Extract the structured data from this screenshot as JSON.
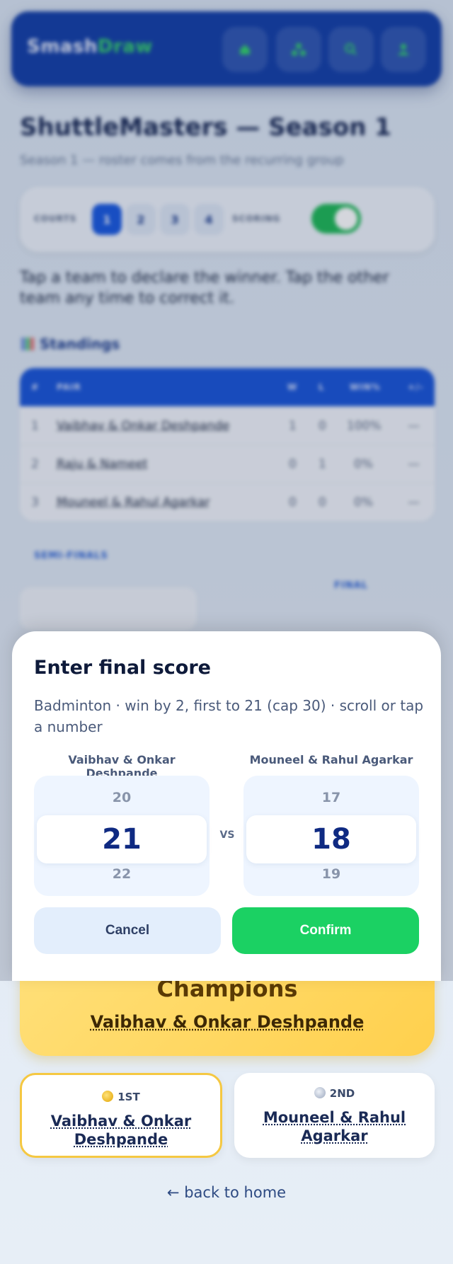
{
  "app": {
    "brand_part1": "Smash",
    "brand_part2": "Draw",
    "nav_icons": [
      "home-icon",
      "tree-icon",
      "search-icon",
      "profile-icon"
    ]
  },
  "page": {
    "title": "ShuttleMasters — Season 1",
    "subtitle": "Season 1 — roster comes from the recurring group",
    "hint": "Tap a team to declare the winner. Tap the other team any time to correct it."
  },
  "controls": {
    "courts_label": "COURTS",
    "courts": [
      "1",
      "2",
      "3",
      "4"
    ],
    "active_court": "1",
    "scoring_label": "SCORING",
    "scoring_on": true
  },
  "standings": {
    "title": "Standings",
    "headers": [
      "#",
      "PAIR",
      "W",
      "L",
      "WIN%",
      "+/-"
    ],
    "rows": [
      {
        "rank": "1",
        "pair": "Vaibhav & Onkar Deshpande",
        "w": "1",
        "l": "0",
        "pct": "100%",
        "diff": "—"
      },
      {
        "rank": "2",
        "pair": "Raju & Nameet",
        "w": "0",
        "l": "1",
        "pct": "0%",
        "diff": "—"
      },
      {
        "rank": "3",
        "pair": "Mouneel & Rahul Agarkar",
        "w": "0",
        "l": "0",
        "pct": "0%",
        "diff": "—"
      }
    ]
  },
  "bracket": {
    "semi_label": "SEMI-FINALS",
    "final_label": "FINAL"
  },
  "champions": {
    "title": "Champions",
    "names": "Vaibhav & Onkar Deshpande"
  },
  "podium": {
    "first_rank": "1ST",
    "first_names": "Vaibhav & Onkar Deshpande",
    "second_rank": "2ND",
    "second_names": "Mouneel & Rahul Agarkar"
  },
  "back_link": "← back to home",
  "modal": {
    "title": "Enter final score",
    "description": "Badminton · win by 2, first to 21 (cap 30) · scroll or tap a number",
    "team_a": "Vaibhav & Onkar Deshpande",
    "team_b": "Mouneel & Rahul Agarkar",
    "vs": "VS",
    "score_a": {
      "prev": "20",
      "current": "21",
      "next": "22"
    },
    "score_b": {
      "prev": "17",
      "current": "18",
      "next": "19"
    },
    "cancel_label": "Cancel",
    "confirm_label": "Confirm"
  },
  "colors": {
    "brand_blue": "#1440a8",
    "accent_green": "#1bd163",
    "champion_gold": "#ffd04d"
  }
}
